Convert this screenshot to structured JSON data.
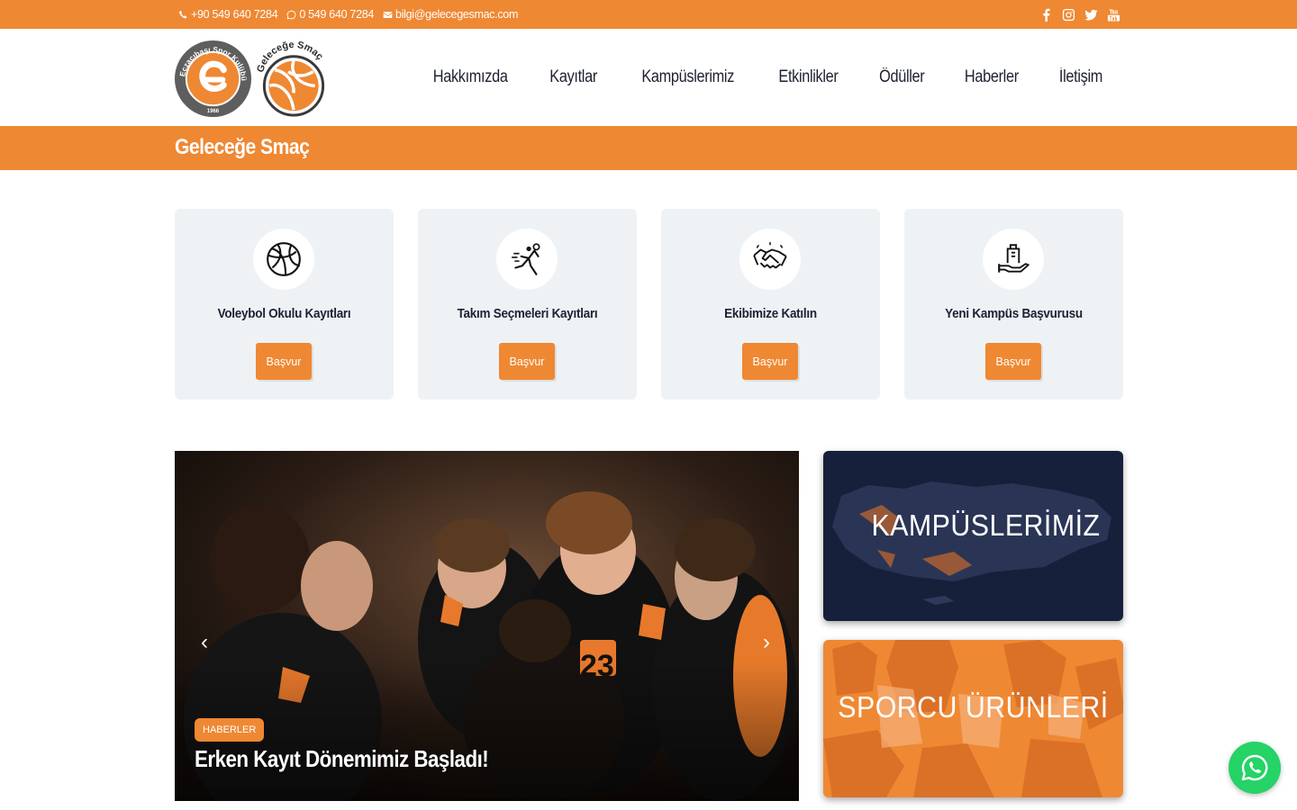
{
  "topbar": {
    "phone": "+90 549 640 7284",
    "whatsapp": "0 549 640 7284",
    "email": "bilgi@gelecegesmac.com",
    "social_icons": [
      "facebook-icon",
      "instagram-icon",
      "twitter-icon",
      "youtube-icon"
    ]
  },
  "logos": {
    "club_text": "Eczacıbaşı Spor Kulübü",
    "club_year": "1966",
    "program_text": "Geleceğe Smaç"
  },
  "nav": [
    "Hakkımızda",
    "Kayıtlar",
    "Kampüslerimiz",
    "Etkinlikler",
    "Ödüller",
    "Haberler",
    "İletişim"
  ],
  "page_title": "Geleceğe Smaç",
  "cards": [
    {
      "title": "Voleybol Okulu Kayıtları",
      "button": "Başvur",
      "icon": "volleyball-icon"
    },
    {
      "title": "Takım Seçmeleri Kayıtları",
      "button": "Başvur",
      "icon": "player-spike-icon"
    },
    {
      "title": "Ekibimize Katılın",
      "button": "Başvur",
      "icon": "handshake-icon"
    },
    {
      "title": "Yeni Kampüs Başvurusu",
      "button": "Başvur",
      "icon": "campus-building-icon"
    }
  ],
  "slider": {
    "badge": "HABERLER",
    "title": "Erken Kayıt Dönemimiz Başladı!",
    "prev": "‹",
    "next": "›"
  },
  "promos": {
    "campuses": "KAMPÜSLERİMİZ",
    "products": "SPORCU ÜRÜNLERİ"
  },
  "colors": {
    "accent": "#ef8833",
    "navy": "#17203a",
    "card_bg": "#eff2f5",
    "whatsapp": "#25d366"
  }
}
